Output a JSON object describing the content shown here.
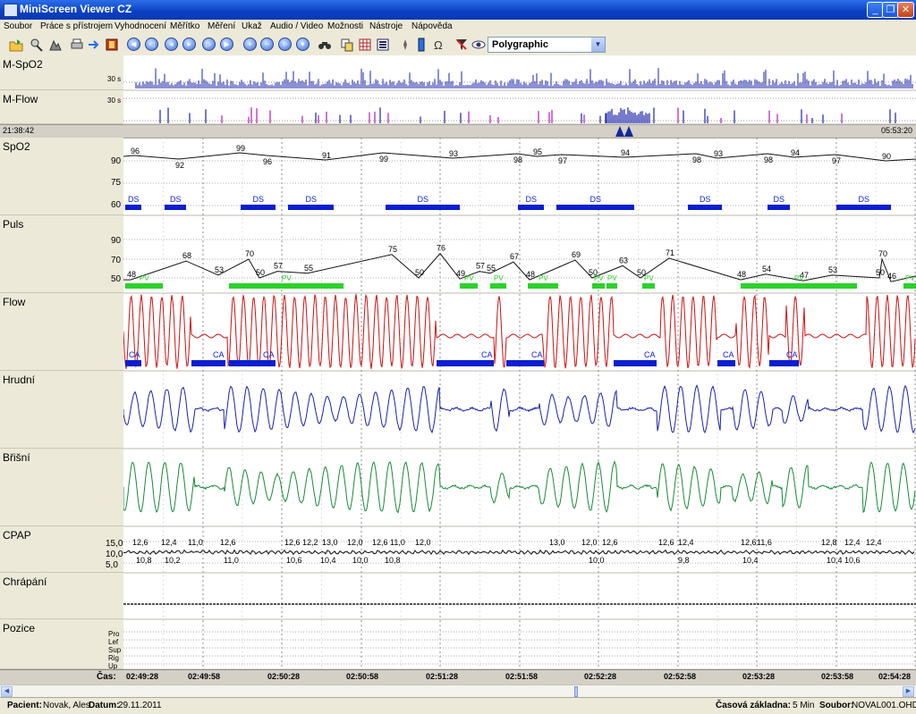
{
  "window": {
    "title": "MiniScreen Viewer CZ"
  },
  "menu": [
    "Soubor",
    "Práce s přístrojem",
    "Vyhodnocení",
    "Měřítko",
    "Měření",
    "Ukaž",
    "Audio / Video",
    "Možnosti",
    "Nástroje",
    "Nápověda"
  ],
  "toolbar": {
    "view_select": "Polygraphic"
  },
  "overview": {
    "channels": [
      {
        "name": "M-SpO2",
        "scale": "30 s"
      },
      {
        "name": "M-Flow",
        "scale": "30 s"
      }
    ],
    "start_time": "21:38:42",
    "end_time": "05:53:20"
  },
  "channels": {
    "spo2": {
      "name": "SpO2",
      "ticks": [
        "90",
        "75",
        "60"
      ],
      "values": [
        "96",
        "92",
        "99",
        "96",
        "91",
        "99",
        "93",
        "98",
        "95",
        "97",
        "94",
        "98",
        "93",
        "98",
        "94",
        "97",
        "90"
      ],
      "event": "DS"
    },
    "puls": {
      "name": "Puls",
      "ticks": [
        "90",
        "70",
        "50"
      ],
      "values": [
        "48",
        "68",
        "53",
        "70",
        "50",
        "57",
        "55",
        "75",
        "50",
        "76",
        "49",
        "57",
        "55",
        "67",
        "48",
        "69",
        "50",
        "63",
        "50",
        "71",
        "48",
        "54",
        "47",
        "53",
        "50",
        "70",
        "46"
      ],
      "event": "PV"
    },
    "flow": {
      "name": "Flow",
      "event": "CA"
    },
    "hrudni": {
      "name": "Hrudní"
    },
    "brisni": {
      "name": "Břišní"
    },
    "cpap": {
      "name": "CPAP",
      "ticks": [
        "15,0",
        "10,0",
        "5,0"
      ],
      "values": [
        "12,6",
        "12,4",
        "11,0",
        "12,6",
        "12,6",
        "12,2",
        "13,0",
        "12,0",
        "12,6",
        "11,0",
        "12,0",
        "13,0",
        "12,0",
        "12,6",
        "12,6",
        "12,4",
        "12,6",
        "11,6",
        "12,8",
        "12,4",
        "12,4",
        "10,8",
        "10,2",
        "11,0",
        "10,6",
        "10,4",
        "10,0",
        "10,8",
        "10,0",
        "9,8",
        "10,4",
        "10,4",
        "10,6"
      ]
    },
    "chrapani": {
      "name": "Chrápání"
    },
    "pozice": {
      "name": "Pozice",
      "ticks": [
        "Pro",
        "Lef",
        "Sup",
        "Rig",
        "Up"
      ]
    }
  },
  "time_axis": {
    "label": "Čas:",
    "ticks": [
      "02:49:28",
      "02:49:58",
      "02:50:28",
      "02:50:58",
      "02:51:28",
      "02:51:58",
      "02:52:28",
      "02:52:58",
      "02:53:28",
      "02:53:58",
      "02:54:28"
    ]
  },
  "status": {
    "patient_label": "Pacient:",
    "patient": "Novak, Ales",
    "date_label": "Datum:",
    "date": "29.11.2011",
    "timebase_label": "Časová základna:",
    "timebase": "5 Min",
    "file_label": "Soubor:",
    "file": "NOVAL001.OHD"
  },
  "colors": {
    "flow": "#cc1111",
    "hrudni": "#1a22aa",
    "brisni": "#188a3a",
    "event_blue": "#0b1fd0",
    "pv_green": "#2bd12b"
  }
}
